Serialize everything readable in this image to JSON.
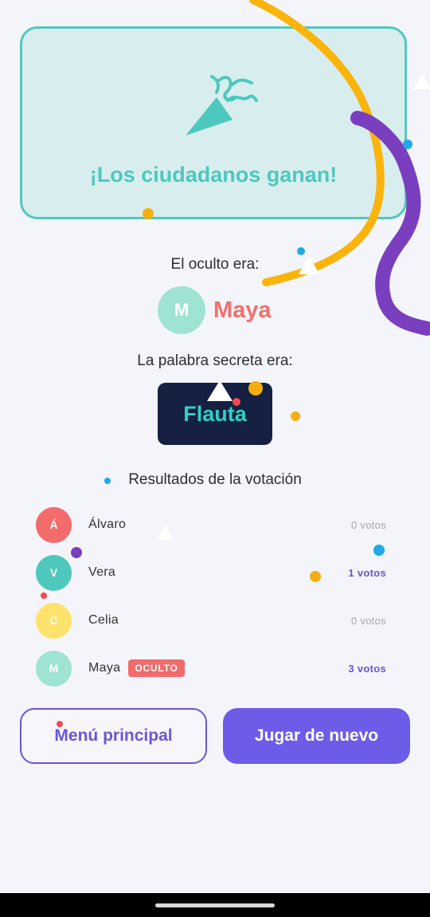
{
  "result": {
    "title": "¡Los ciudadanos ganan!",
    "icon": "party-popper-icon"
  },
  "hidden_player": {
    "label": "El oculto era:",
    "initial": "M",
    "name": "Maya"
  },
  "secret_word": {
    "label": "La palabra secreta era:",
    "word": "Flauta"
  },
  "voting": {
    "title": "Resultados de la votación",
    "rows": [
      {
        "initial": "Á",
        "name": "Álvaro",
        "votes": "0 votos",
        "color": "#f46b6b",
        "badge": ""
      },
      {
        "initial": "V",
        "name": "Vera",
        "votes": "1 votos",
        "color": "#4ec8bd",
        "badge": ""
      },
      {
        "initial": "C",
        "name": "Celia",
        "votes": "0 votos",
        "color": "#fde36b",
        "badge": ""
      },
      {
        "initial": "M",
        "name": "Maya",
        "votes": "3 votos",
        "color": "#9ee3d3",
        "badge": "OCULTO"
      }
    ]
  },
  "buttons": {
    "main_menu": "Menú principal",
    "play_again": "Jugar de nuevo"
  },
  "colors": {
    "accent": "#6c5ce7",
    "teal": "#4ec8bd",
    "coral": "#f26f6a",
    "dark": "#152042"
  }
}
